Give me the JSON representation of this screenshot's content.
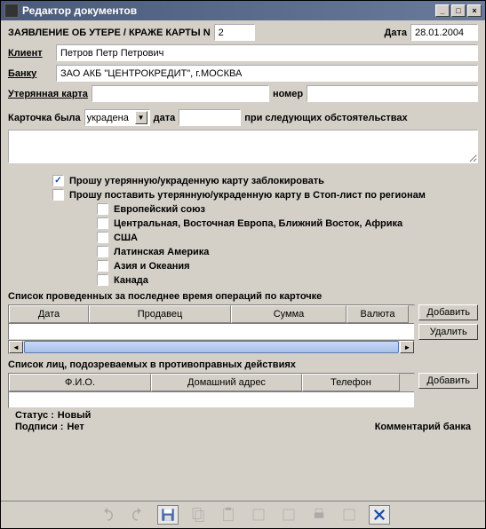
{
  "window": {
    "title": "Редактор документов"
  },
  "header": {
    "form_title": "ЗАЯВЛЕНИЕ ОБ УТЕРЕ / КРАЖЕ КАРТЫ N",
    "number": "2",
    "date_label": "Дата",
    "date_value": "28.01.2004"
  },
  "fields": {
    "client_label": "Клиент",
    "client_value": "Петров Петр Петрович",
    "bank_label": "Банку",
    "bank_value": "ЗАО АКБ \"ЦЕНТРОКРЕДИТ\", г.МОСКВА",
    "lost_card_label": "Утерянная карта",
    "lost_card_value": "",
    "card_number_label": "номер",
    "card_number_value": "",
    "card_was_label": "Карточка была",
    "card_was_value": "украдена",
    "on_date_label": "дата",
    "on_date_value": "",
    "circumstances_label": "при следующих обстоятельствах"
  },
  "checkboxes": {
    "block_card": {
      "label": "Прошу утерянную/украденную карту заблокировать",
      "checked": true
    },
    "stop_list": {
      "label": "Прошу поставить утерянную/украденную карту в Стоп-лист по регионам",
      "checked": false
    },
    "regions": [
      {
        "label": "Европейский союз",
        "checked": false
      },
      {
        "label": "Центральная, Восточная Европа, Ближний Восток, Африка",
        "checked": false
      },
      {
        "label": "США",
        "checked": false
      },
      {
        "label": "Латинская Америка",
        "checked": false
      },
      {
        "label": "Азия и Океания",
        "checked": false
      },
      {
        "label": "Канада",
        "checked": false
      }
    ]
  },
  "operations_table": {
    "title": "Список проведенных за последнее время операций по карточке",
    "columns": [
      "Дата",
      "Продавец",
      "Сумма",
      "Валюта"
    ]
  },
  "suspects_table": {
    "title": "Список лиц, подозреваемых в противоправных действиях",
    "columns": [
      "Ф.И.О.",
      "Домашний адрес",
      "Телефон"
    ]
  },
  "buttons": {
    "add": "Добавить",
    "delete": "Удалить"
  },
  "status": {
    "status_label": "Статус :",
    "status_value": "Новый",
    "signatures_label": "Подписи :",
    "signatures_value": "Нет",
    "bank_comment": "Комментарий банка"
  }
}
